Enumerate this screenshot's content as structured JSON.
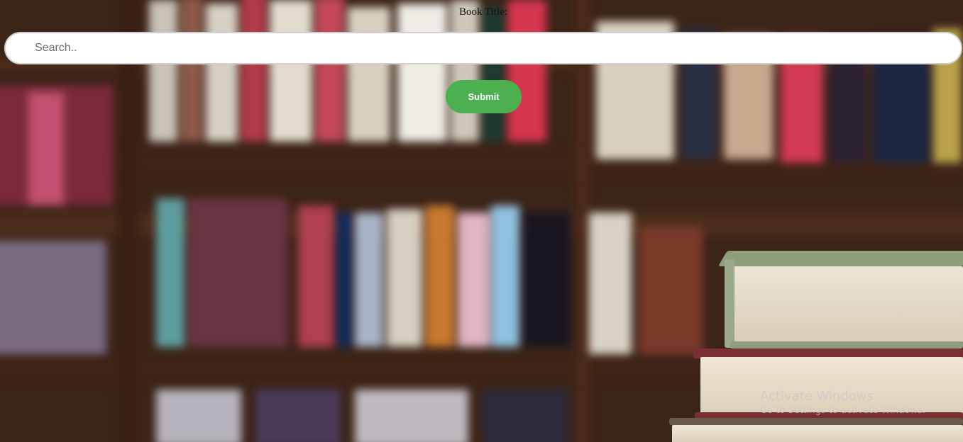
{
  "form": {
    "label": "Book Title:",
    "search_placeholder": "Search..",
    "search_value": "",
    "submit_label": "Submit"
  },
  "watermark": {
    "title": "Activate Windows",
    "subtitle": "Go to Settings to activate Windows."
  },
  "colors": {
    "submit_bg": "#4caf50",
    "background": "#3b2418"
  }
}
